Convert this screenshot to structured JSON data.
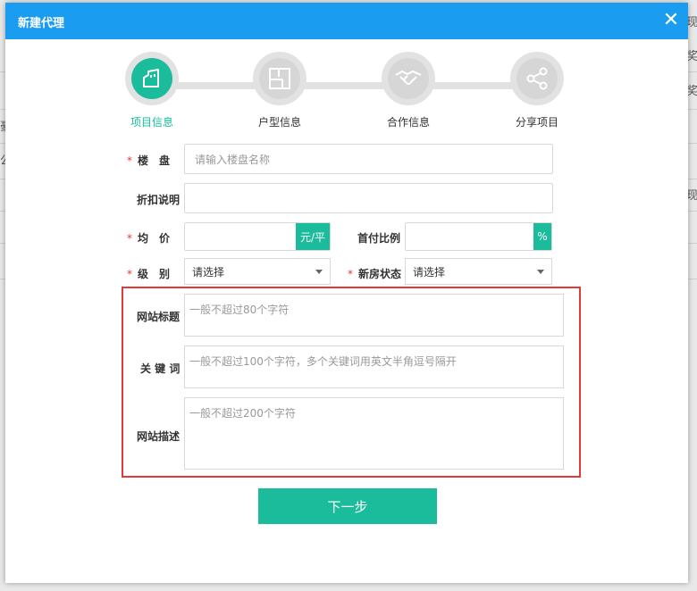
{
  "dialog": {
    "title": "新建代理",
    "close_symbol": "✕"
  },
  "steps": [
    {
      "label": "项目信息",
      "icon": "building-icon",
      "active": true
    },
    {
      "label": "户型信息",
      "icon": "floor-plan-icon",
      "active": false
    },
    {
      "label": "合作信息",
      "icon": "handshake-icon",
      "active": false
    },
    {
      "label": "分享项目",
      "icon": "share-icon",
      "active": false
    }
  ],
  "form": {
    "building": {
      "label": "楼　盘",
      "required": true,
      "placeholder": "请输入楼盘名称"
    },
    "discount": {
      "label": "折扣说明",
      "required": false,
      "value": ""
    },
    "avg_price": {
      "label": "均　价",
      "required": true,
      "value": "",
      "unit": "元/平"
    },
    "down_payment": {
      "label": "首付比例",
      "required": false,
      "value": "",
      "unit": "%"
    },
    "level": {
      "label": "级　别",
      "required": true,
      "selected": "请选择"
    },
    "house_status": {
      "label": "新房状态",
      "required": true,
      "selected": "请选择"
    },
    "site_title": {
      "label": "网站标题",
      "placeholder": "一般不超过80个字符"
    },
    "keywords": {
      "label": "关 键 词",
      "placeholder": "一般不超过100个字符，多个关键词用英文半角逗号隔开"
    },
    "site_desc": {
      "label": "网站描述",
      "placeholder": "一般不超过200个字符"
    }
  },
  "next_button": {
    "label": "下一步"
  },
  "background": {
    "chars": [
      "现",
      "奖",
      "奖",
      "豪",
      "公",
      "现"
    ]
  },
  "colors": {
    "titlebar": "#1a9cf0",
    "accent": "#1abc9c",
    "highlight": "#e53a3a",
    "required": "#e03a3a"
  }
}
